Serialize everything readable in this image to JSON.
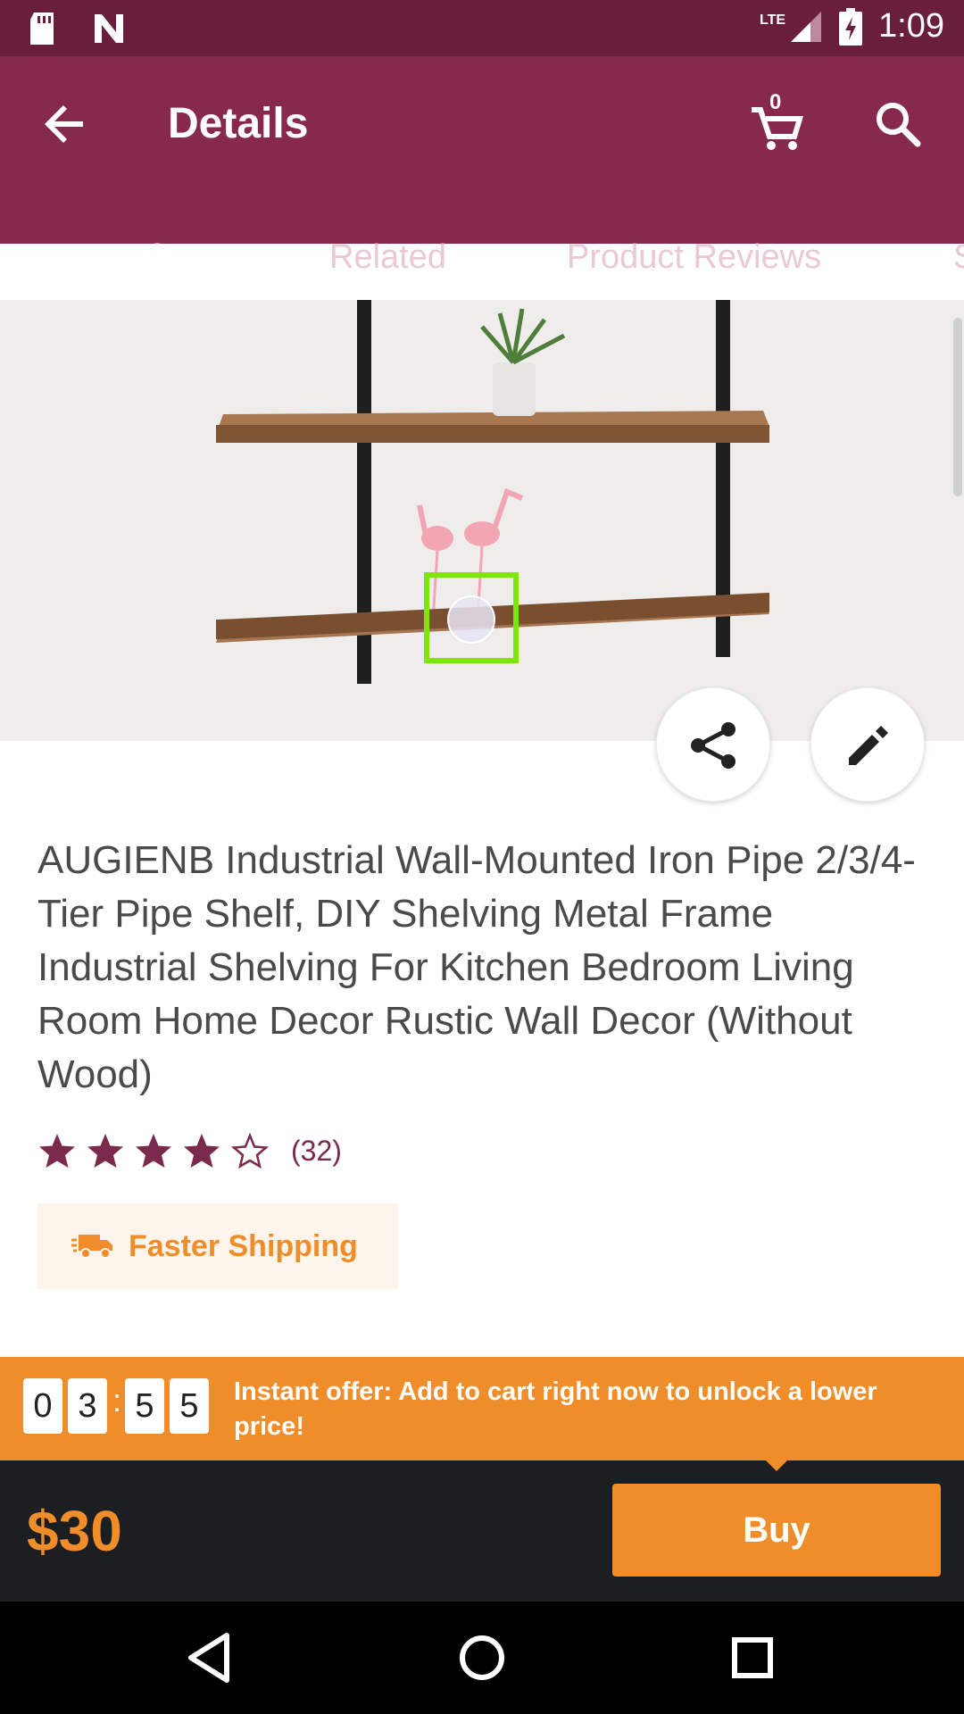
{
  "status_bar": {
    "time": "1:09",
    "network": "LTE"
  },
  "header": {
    "title": "Details",
    "cart_count": "0"
  },
  "tabs": [
    {
      "label": "Overview",
      "active": true
    },
    {
      "label": "Related",
      "active": false
    },
    {
      "label": "Product Reviews",
      "active": false
    },
    {
      "label": "S",
      "active": false
    }
  ],
  "product": {
    "title": "AUGIENB Industrial Wall-Mounted Iron Pipe 2/3/4-Tier Pipe Shelf, DIY Shelving Metal Frame Industrial Shelving For Kitchen Bedroom Living Room Home Decor Rustic Wall Decor (Without Wood)",
    "rating": 4,
    "rating_max": 5,
    "review_count": "(32)",
    "shipping_badge": "Faster Shipping"
  },
  "offer": {
    "timer_digits": [
      "0",
      "3",
      "5",
      "5"
    ],
    "separator": ":",
    "text": "Instant offer: Add to cart right now to unlock a lower price!"
  },
  "purchase": {
    "price": "$30",
    "buy_label": "Buy"
  },
  "icons": {
    "back": "back-arrow-icon",
    "cart": "cart-icon",
    "search": "search-icon",
    "share": "share-icon",
    "edit": "edit-pencil-icon",
    "truck": "truck-icon",
    "nav_back": "nav-back-icon",
    "nav_home": "nav-home-icon",
    "nav_recents": "nav-recents-icon"
  },
  "colors": {
    "primary": "#87294f",
    "primary_dark": "#6a1e3d",
    "accent": "#ef8d2a",
    "star": "#7a2a4c",
    "dark_bar": "#1c1f22"
  }
}
